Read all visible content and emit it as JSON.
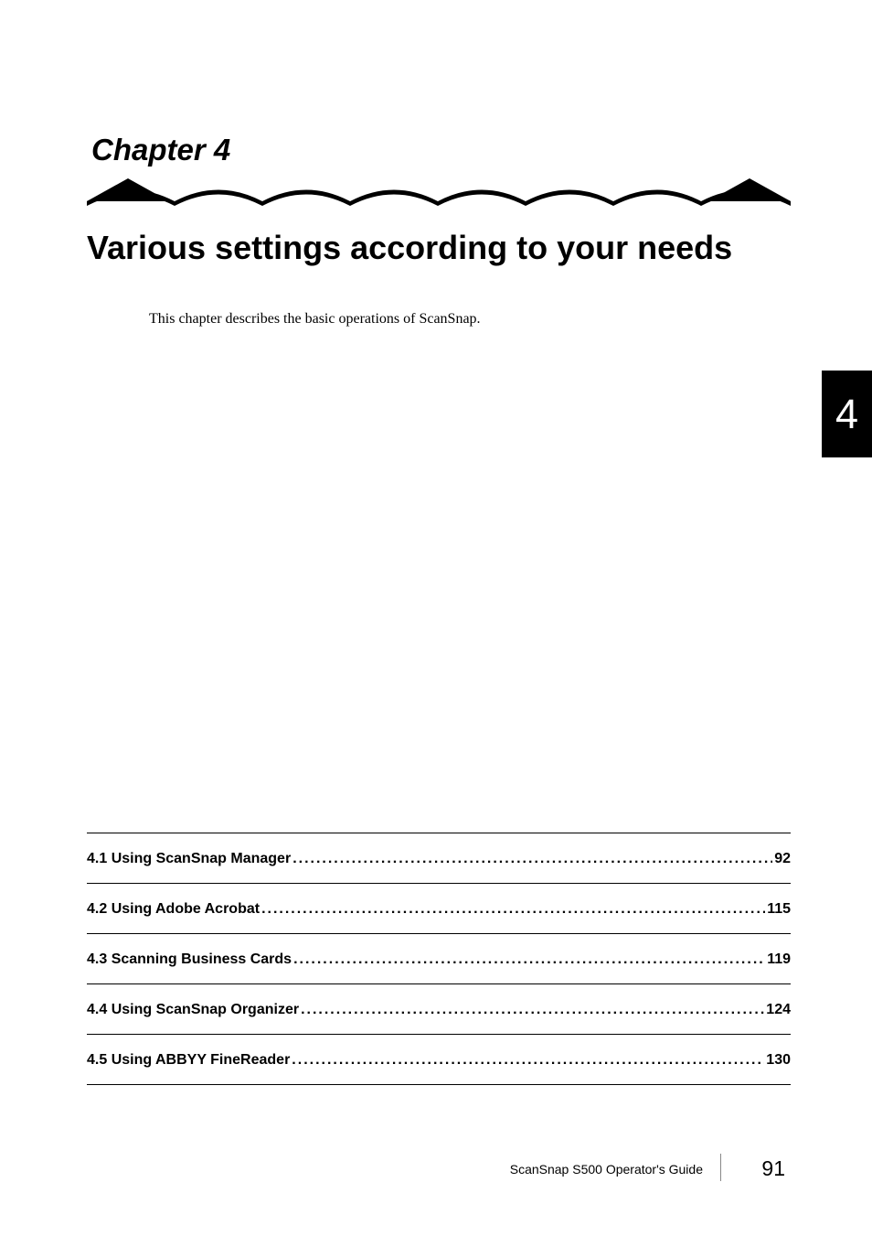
{
  "chapter_label": "Chapter 4",
  "chapter_title": "Various settings according to your needs",
  "chapter_description": "This chapter describes the basic operations of ScanSnap.",
  "chapter_number": "4",
  "toc": [
    {
      "title": "4.1 Using ScanSnap Manager",
      "page": "92"
    },
    {
      "title": "4.2 Using Adobe Acrobat",
      "page": "115"
    },
    {
      "title": "4.3 Scanning Business Cards",
      "page": "119"
    },
    {
      "title": "4.4 Using ScanSnap Organizer",
      "page": "124"
    },
    {
      "title": "4.5 Using ABBYY FineReader",
      "page": "130"
    }
  ],
  "footer_guide": "ScanSnap  S500 Operator's Guide",
  "page_number": "91"
}
